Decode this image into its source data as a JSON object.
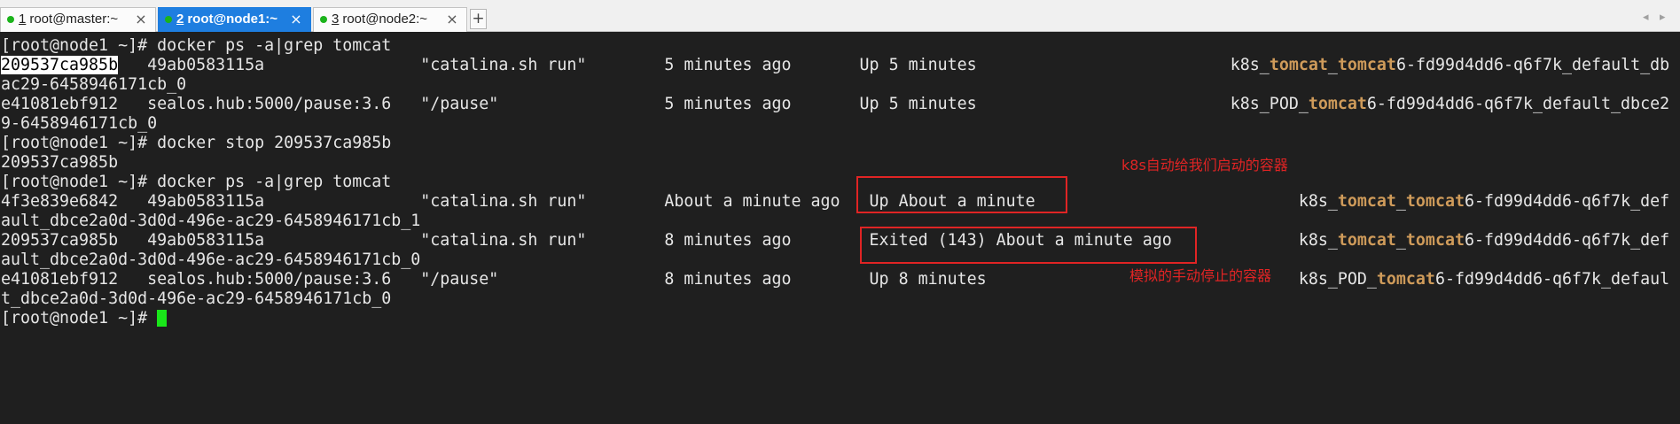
{
  "tabs": [
    {
      "number": "1",
      "title": "root@master:~",
      "active": false
    },
    {
      "number": "2",
      "title": "root@node1:~",
      "active": true
    },
    {
      "number": "3",
      "title": "root@node2:~",
      "active": false
    }
  ],
  "icons": {
    "tab_status": "status-dot-icon",
    "tab_close": "close-icon",
    "new_tab": "plus-icon",
    "scroll_left": "chevron-left-icon",
    "scroll_right": "chevron-right-icon"
  },
  "colors": {
    "accent": "#1e7ee0",
    "status_dot": "#1bb31b",
    "terminal_bg": "#1f1f1f",
    "terminal_fg": "#e6e6e6",
    "grep_match": "#cf9b5a",
    "cursor": "#19e619",
    "annotation": "#e02424",
    "selection_bg": "#ffffff",
    "selection_fg": "#000000"
  },
  "terminal": {
    "lines": [
      [
        {
          "text": "[root@node1 ~]# docker ps -a|grep tomcat"
        }
      ],
      [
        {
          "text": "209537ca985b",
          "selected": true
        },
        {
          "text": "   49ab0583115a                \"catalina.sh run\"        5 minutes ago       Up 5 minutes                          k8s_"
        },
        {
          "text": "tomcat",
          "match": true
        },
        {
          "text": "_"
        },
        {
          "text": "tomcat",
          "match": true
        },
        {
          "text": "6-fd99d4dd6-q6f7k_default_db"
        }
      ],
      [
        {
          "text": "ac29-6458946171cb_0"
        }
      ],
      [
        {
          "text": "e41081ebf912   sealos.hub:5000/pause:3.6   \"/pause\"                 5 minutes ago       Up 5 minutes                          k8s_POD_"
        },
        {
          "text": "tomcat",
          "match": true
        },
        {
          "text": "6-fd99d4dd6-q6f7k_default_dbce2"
        }
      ],
      [
        {
          "text": "9-6458946171cb_0"
        }
      ],
      [
        {
          "text": "[root@node1 ~]# docker stop 209537ca985b"
        }
      ],
      [
        {
          "text": "209537ca985b"
        }
      ],
      [
        {
          "text": "[root@node1 ~]# docker ps -a|grep tomcat"
        }
      ],
      [
        {
          "text": "4f3e839e6842   49ab0583115a                \"catalina.sh run\"        About a minute ago   Up About a minute                           k8s_"
        },
        {
          "text": "tomcat",
          "match": true
        },
        {
          "text": "_"
        },
        {
          "text": "tomcat",
          "match": true
        },
        {
          "text": "6-fd99d4dd6-q6f7k_def"
        }
      ],
      [
        {
          "text": "ault_dbce2a0d-3d0d-496e-ac29-6458946171cb_1"
        }
      ],
      [
        {
          "text": "209537ca985b   49ab0583115a                \"catalina.sh run\"        8 minutes ago        Exited (143) About a minute ago             k8s_"
        },
        {
          "text": "tomcat",
          "match": true
        },
        {
          "text": "_"
        },
        {
          "text": "tomcat",
          "match": true
        },
        {
          "text": "6-fd99d4dd6-q6f7k_def"
        }
      ],
      [
        {
          "text": "ault_dbce2a0d-3d0d-496e-ac29-6458946171cb_0"
        }
      ],
      [
        {
          "text": "e41081ebf912   sealos.hub:5000/pause:3.6   \"/pause\"                 8 minutes ago        Up 8 minutes                                k8s_POD_"
        },
        {
          "text": "tomcat",
          "match": true
        },
        {
          "text": "6-fd99d4dd6-q6f7k_defaul"
        }
      ],
      [
        {
          "text": "t_dbce2a0d-3d0d-496e-ac29-6458946171cb_0"
        }
      ],
      [
        {
          "text": "[root@node1 ~]# "
        }
      ]
    ],
    "cursor_visible": true
  },
  "annotations": [
    {
      "text": "k8s自动给我们启动的容器"
    },
    {
      "text": "模拟的手动停止的容器"
    }
  ]
}
